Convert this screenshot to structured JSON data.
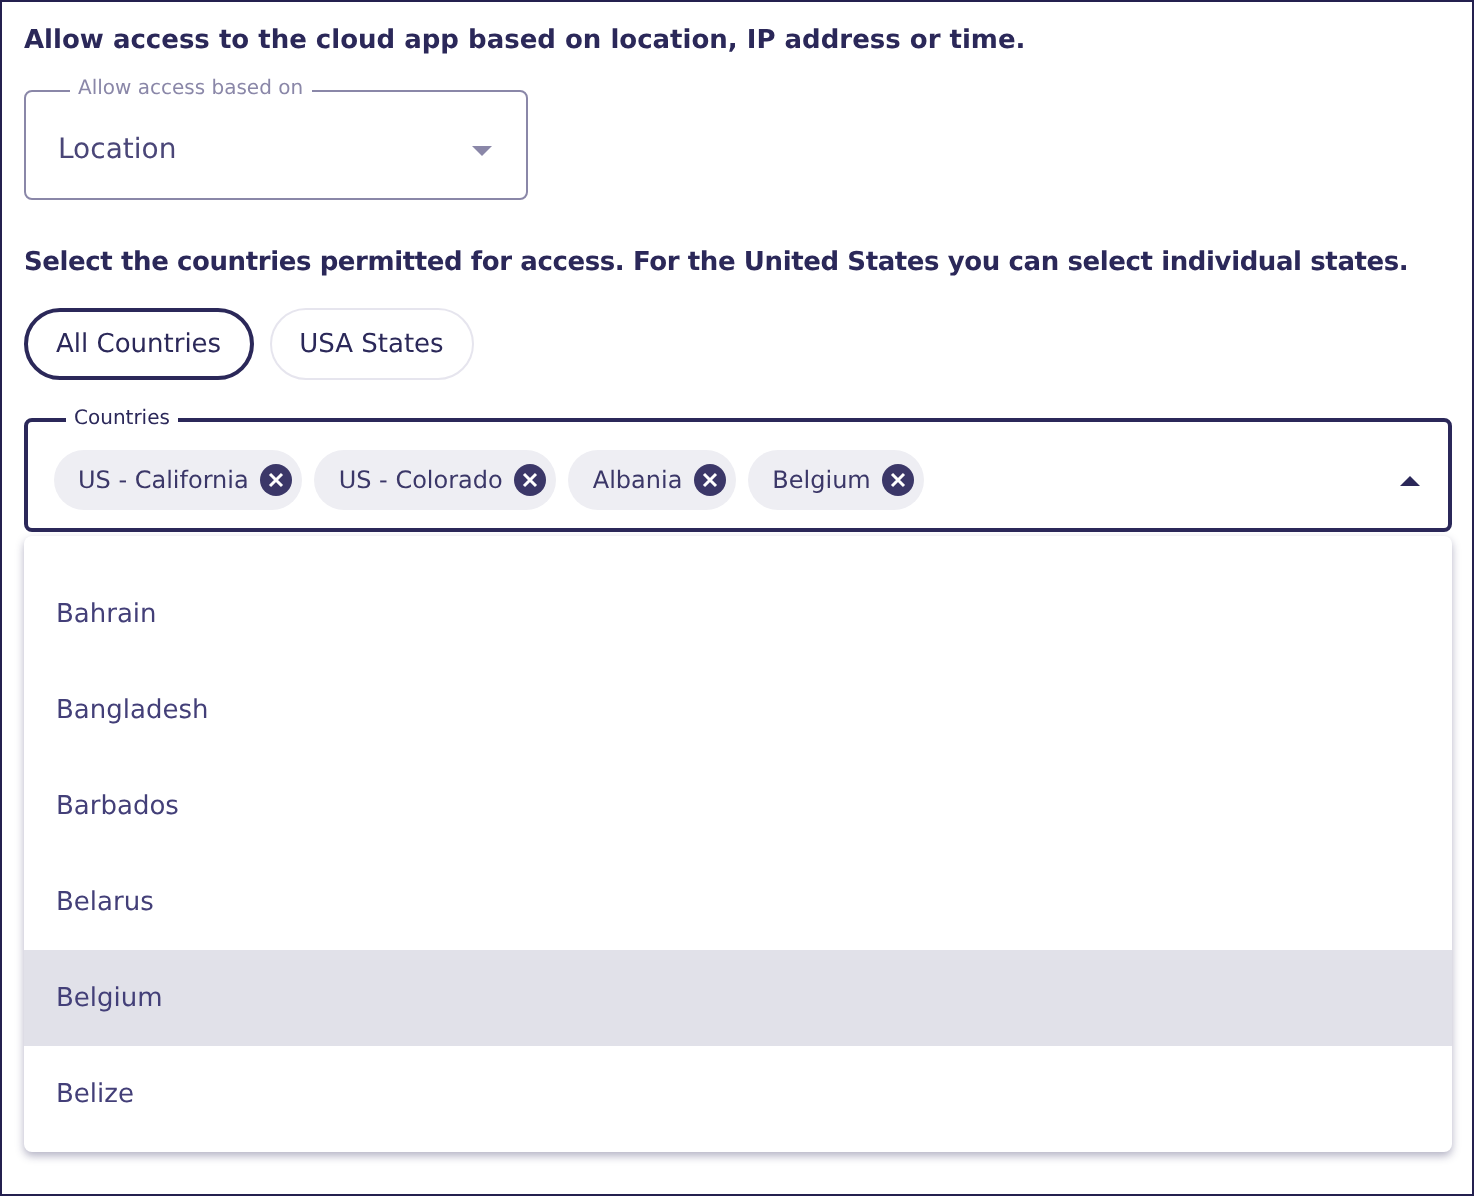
{
  "heading": "Allow access to the cloud app based on location, IP address or time.",
  "access_select": {
    "label": "Allow access based on",
    "value": "Location"
  },
  "instructions": "Select the countries permitted for access. For the United States you can select individual states.",
  "toggles": [
    {
      "label": "All Countries",
      "selected": true
    },
    {
      "label": "USA States",
      "selected": false
    }
  ],
  "countries_field": {
    "label": "Countries",
    "expanded": true,
    "chips": [
      "US - California",
      "US - Colorado",
      "Albania",
      "Belgium"
    ]
  },
  "options": [
    {
      "label": "Bahrain",
      "selected": false
    },
    {
      "label": "Bangladesh",
      "selected": false
    },
    {
      "label": "Barbados",
      "selected": false
    },
    {
      "label": "Belarus",
      "selected": false
    },
    {
      "label": "Belgium",
      "selected": true
    },
    {
      "label": "Belize",
      "selected": false
    }
  ]
}
